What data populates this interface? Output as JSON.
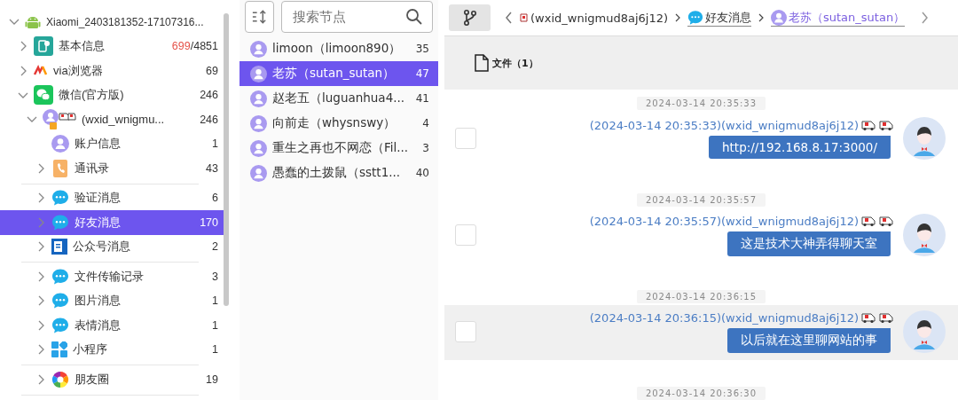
{
  "tree": [
    {
      "kind": "android",
      "label": "Xiaomi_2403181352-17107316...",
      "expanded": true,
      "selected": false,
      "children": [
        {
          "kind": "app-info",
          "label": "基本信息",
          "count_new": "699",
          "count": "/4851",
          "expanded": false,
          "selected": false
        },
        {
          "kind": "browser",
          "label": "via浏览器",
          "count": "69",
          "expanded": false,
          "selected": false
        },
        {
          "kind": "wechat",
          "label": "微信(官方版)",
          "count": "246",
          "expanded": true,
          "selected": false,
          "children": [
            {
              "kind": "account",
              "label": "(wxid_wnigmu...",
              "count": "246",
              "expanded": true,
              "selected": false,
              "children": [
                {
                  "kind": "user",
                  "label": "账户信息",
                  "count": "1",
                  "selected": false
                },
                {
                  "kind": "contacts",
                  "label": "通讯录",
                  "count": "43",
                  "expanded": false,
                  "selected": false,
                  "divider": true
                },
                {
                  "kind": "chat",
                  "label": "验证消息",
                  "count": "6",
                  "expanded": false,
                  "selected": false
                },
                {
                  "kind": "chat",
                  "label": "好友消息",
                  "count": "170",
                  "expanded": false,
                  "selected": true
                },
                {
                  "kind": "official",
                  "label": "公众号消息",
                  "count": "2",
                  "expanded": false,
                  "selected": false,
                  "divider": true
                },
                {
                  "kind": "chat",
                  "label": "文件传输记录",
                  "count": "3",
                  "expanded": false,
                  "selected": false
                },
                {
                  "kind": "chat",
                  "label": "图片消息",
                  "count": "1",
                  "expanded": false,
                  "selected": false
                },
                {
                  "kind": "chat",
                  "label": "表情消息",
                  "count": "1",
                  "expanded": false,
                  "selected": false
                },
                {
                  "kind": "miniprogram",
                  "label": "小程序",
                  "count": "1",
                  "expanded": false,
                  "selected": false,
                  "divider": true
                },
                {
                  "kind": "moments",
                  "label": "朋友圈",
                  "count": "19",
                  "expanded": false,
                  "selected": false,
                  "divider": true
                }
              ]
            }
          ]
        }
      ]
    }
  ],
  "search": {
    "placeholder": "搜索节点"
  },
  "contacts": [
    {
      "name": "limoon（limoon890）",
      "count": "35",
      "selected": false
    },
    {
      "name": "老苏（sutan_sutan）",
      "count": "47",
      "selected": true
    },
    {
      "name": "赵老五（luguanhua4...",
      "count": "41",
      "selected": false
    },
    {
      "name": "向前走（whysnswy）",
      "count": "4",
      "selected": false
    },
    {
      "name": "重生之再也不网恋（Fil...",
      "count": "3",
      "selected": false
    },
    {
      "name": "愚蠢的土拨鼠（sstt1...",
      "count": "40",
      "selected": false
    }
  ],
  "breadcrumb": [
    {
      "kind": "account",
      "label": "(wxid_wnigmud8aj6j12)",
      "selected": false
    },
    {
      "kind": "chat",
      "label": "好友消息",
      "selected": false
    },
    {
      "kind": "user",
      "label": "老苏（sutan_sutan）",
      "selected": true
    }
  ],
  "toolbar": {
    "files_label": "文件（1）"
  },
  "messages": [
    {
      "time": "2024-03-14 20:35:33",
      "header": "(2024-03-14 20:35:33)(wxid_wnigmud8aj6j12)",
      "text": "http://192.168.8.17:3000/",
      "checked": false,
      "highlighted": false
    },
    {
      "time": "2024-03-14 20:35:57",
      "header": "(2024-03-14 20:35:57)(wxid_wnigmud8aj6j12)",
      "text": "这是技术大神弄得聊天室",
      "checked": false,
      "highlighted": false
    },
    {
      "time": "2024-03-14 20:36:15",
      "header": "(2024-03-14 20:36:15)(wxid_wnigmud8aj6j12)",
      "text": "以后就在这里聊网站的事",
      "checked": false,
      "highlighted": true
    },
    {
      "time": "2024-03-14 20:36:30"
    }
  ]
}
